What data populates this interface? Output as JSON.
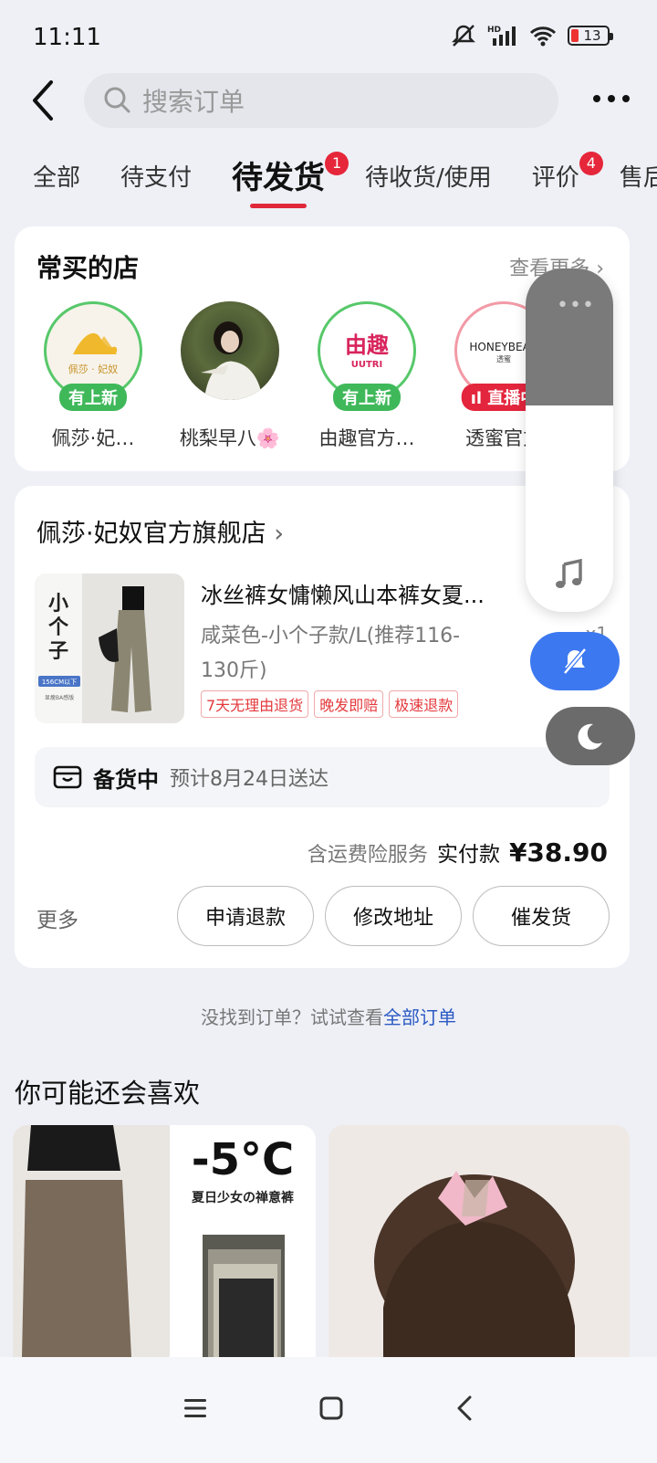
{
  "status_bar": {
    "time": "11:11",
    "battery": "13",
    "network": "HD"
  },
  "header": {
    "search_placeholder": "搜索订单"
  },
  "tabs": [
    {
      "label": "全部",
      "badge": ""
    },
    {
      "label": "待支付",
      "badge": ""
    },
    {
      "label": "待发货",
      "badge": "1",
      "active": true
    },
    {
      "label": "待收货/使用",
      "badge": ""
    },
    {
      "label": "评价",
      "badge": "4"
    },
    {
      "label": "售后",
      "badge": ""
    }
  ],
  "frequent_shops": {
    "title": "常买的店",
    "more": "查看更多",
    "shops": [
      {
        "name": "佩莎·妃…",
        "tag": "有上新",
        "logo_text": "佩莎 · 妃奴"
      },
      {
        "name": "桃梨早八🌸",
        "tag": ""
      },
      {
        "name": "由趣官方…",
        "tag": "有上新",
        "logo_text": "UUTRI"
      },
      {
        "name": "透蜜官方",
        "tag": "直播中",
        "logo_text": "HONEYBEAU"
      }
    ]
  },
  "order": {
    "store": "佩莎·妃奴官方旗舰店",
    "product_title": "冰丝裤女慵懒风山本裤女夏...",
    "spec": "咸菜色-小个子款/L(推荐116-130斤)",
    "qty": "x1",
    "image_text": {
      "big": "小个子",
      "badge": "156CM以下",
      "sub": "显瘦BA感版"
    },
    "service_tags": [
      "7天无理由退货",
      "晚发即赔",
      "极速退款"
    ],
    "status": "备货中",
    "eta": "预计8月24日送达",
    "insurance": "含运费险服务",
    "paid_label": "实付款",
    "amount": "¥38.90",
    "more": "更多",
    "actions": [
      "申请退款",
      "修改地址",
      "催发货"
    ]
  },
  "not_found": {
    "text": "没找到订单？试试查看",
    "link": "全部订单"
  },
  "recommend": {
    "title": "你可能还会喜欢",
    "item1_text": {
      "temp": "-5°C",
      "slogan": "夏日少女の禅意裤"
    }
  },
  "colors": {
    "accent": "#e0283a",
    "badge": "#e6263a",
    "link": "#2b59c3",
    "tag_green": "#3fb85a",
    "mute_blue": "#3c78f0"
  }
}
